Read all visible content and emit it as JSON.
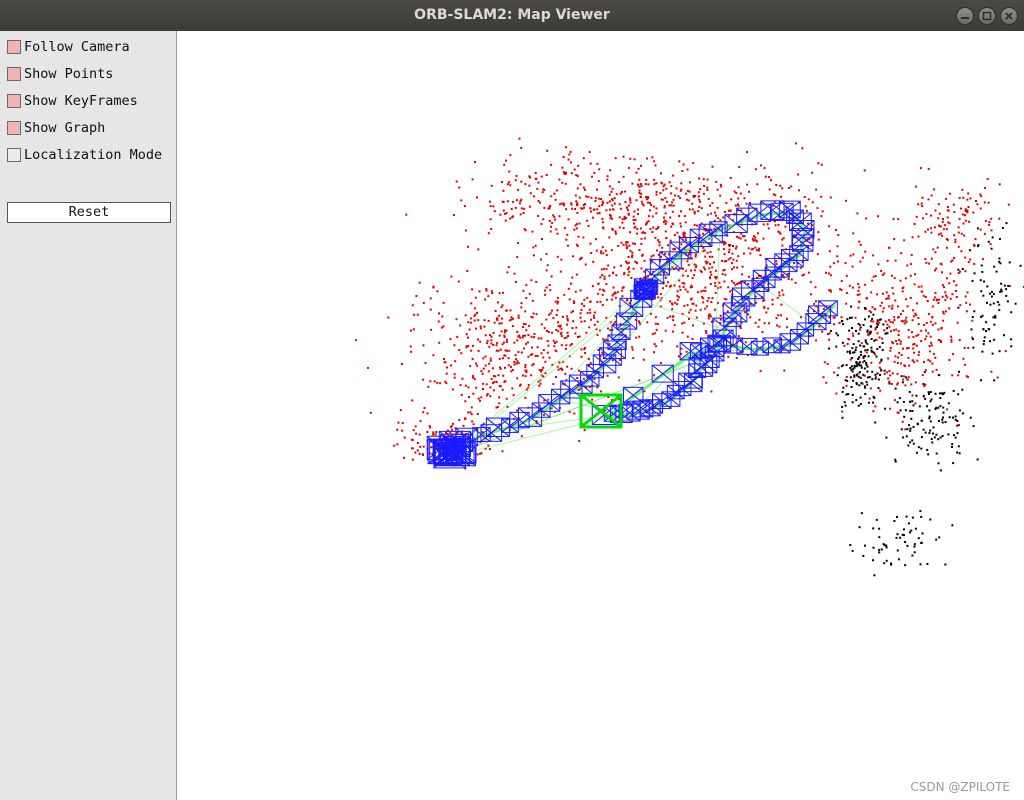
{
  "window": {
    "title": "ORB-SLAM2: Map Viewer"
  },
  "panel": {
    "options": [
      {
        "label": "Follow Camera",
        "checked": true
      },
      {
        "label": "Show Points",
        "checked": true
      },
      {
        "label": "Show KeyFrames",
        "checked": true
      },
      {
        "label": "Show Graph",
        "checked": true
      },
      {
        "label": "Localization Mode",
        "checked": false
      }
    ],
    "reset_label": "Reset"
  },
  "viewer": {
    "watermark": "CSDN @ZPILOTE"
  },
  "colors": {
    "map_points": "#e00000",
    "reference_points": "#000000",
    "keyframes": "#1a1aff",
    "graph": "#55ee55",
    "current_camera": "#00dd00",
    "checkbox_checked": "#f4b3b3"
  }
}
